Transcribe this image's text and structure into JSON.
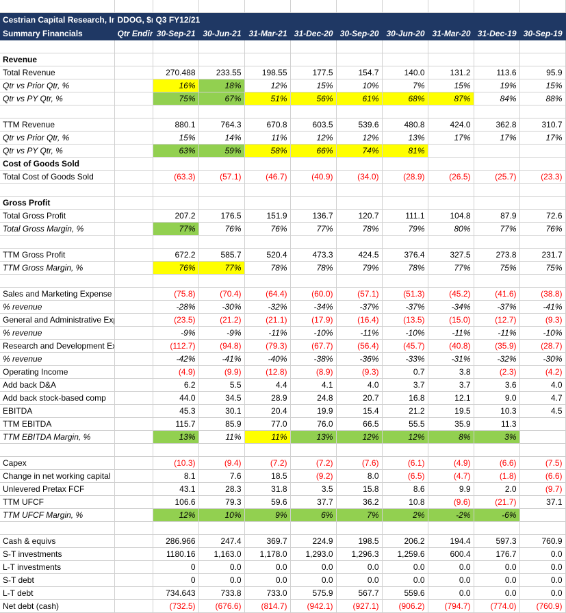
{
  "header": {
    "company_line1": "Cestrian Capital Research, Inc",
    "company_line2": "Summary Financials",
    "ticker": "DDOG, $m",
    "period": "Q3 FY12/21",
    "qtr_ending_label": "Qtr Ending",
    "columns": [
      "30-Sep-21",
      "30-Jun-21",
      "31-Mar-21",
      "31-Dec-20",
      "30-Sep-20",
      "30-Jun-20",
      "31-Mar-20",
      "31-Dec-19",
      "30-Sep-19"
    ]
  },
  "colors": {
    "header_navy": "#1F3864",
    "highlight_yellow": "#FFFF00",
    "highlight_green": "#92D050",
    "negative_red": "#FF0000"
  },
  "sections": [
    {
      "kind": "spacer"
    },
    {
      "kind": "title",
      "label": "Revenue"
    },
    {
      "kind": "row",
      "label": "Total Revenue",
      "style": "plain",
      "topRule": true,
      "values": [
        "270.488",
        "233.55",
        "198.55",
        "177.5",
        "154.7",
        "140.0",
        "131.2",
        "113.6",
        "95.9"
      ]
    },
    {
      "kind": "row",
      "label": "Qtr vs Prior Qtr, %",
      "style": "ital",
      "values": [
        "16%",
        "18%",
        "12%",
        "15%",
        "10%",
        "7%",
        "15%",
        "19%",
        "15%"
      ],
      "fills": [
        "y",
        "g",
        "",
        "",
        "",
        "",
        "",
        "",
        ""
      ]
    },
    {
      "kind": "row",
      "label": "Qtr vs PY Qtr, %",
      "style": "ital",
      "values": [
        "75%",
        "67%",
        "51%",
        "56%",
        "61%",
        "68%",
        "87%",
        "84%",
        "88%"
      ],
      "fills": [
        "g",
        "g",
        "y",
        "y",
        "y",
        "y",
        "y",
        "",
        ""
      ]
    },
    {
      "kind": "spacer"
    },
    {
      "kind": "row",
      "label": "TTM Revenue",
      "style": "plain",
      "values": [
        "880.1",
        "764.3",
        "670.8",
        "603.5",
        "539.6",
        "480.8",
        "424.0",
        "362.8",
        "310.7"
      ]
    },
    {
      "kind": "row",
      "label": "Qtr vs Prior Qtr, %",
      "style": "ital",
      "values": [
        "15%",
        "14%",
        "11%",
        "12%",
        "12%",
        "13%",
        "17%",
        "17%",
        "17%"
      ]
    },
    {
      "kind": "row",
      "label": "Qtr vs PY Qtr, %",
      "style": "ital",
      "values": [
        "63%",
        "59%",
        "58%",
        "66%",
        "74%",
        "81%",
        "",
        "",
        ""
      ],
      "fills": [
        "g",
        "g",
        "y",
        "y",
        "y",
        "y",
        "",
        "",
        ""
      ]
    },
    {
      "kind": "title",
      "label": "Cost of Goods Sold"
    },
    {
      "kind": "row",
      "label": "Total Cost of Goods Sold",
      "style": "neg",
      "values": [
        "(63.3)",
        "(57.1)",
        "(46.7)",
        "(40.9)",
        "(34.0)",
        "(28.9)",
        "(26.5)",
        "(25.7)",
        "(23.3)"
      ]
    },
    {
      "kind": "spacer"
    },
    {
      "kind": "title",
      "label": "Gross Profit"
    },
    {
      "kind": "row",
      "label": "Total Gross Profit",
      "style": "plain",
      "values": [
        "207.2",
        "176.5",
        "151.9",
        "136.7",
        "120.7",
        "111.1",
        "104.8",
        "87.9",
        "72.6"
      ]
    },
    {
      "kind": "row",
      "label": "Total Gross Margin, %",
      "style": "ital",
      "values": [
        "77%",
        "76%",
        "76%",
        "77%",
        "78%",
        "79%",
        "80%",
        "77%",
        "76%"
      ],
      "fills": [
        "g",
        "",
        "",
        "",
        "",
        "",
        "",
        "",
        ""
      ]
    },
    {
      "kind": "spacer"
    },
    {
      "kind": "row",
      "label": "TTM Gross Profit",
      "style": "plain",
      "values": [
        "672.2",
        "585.7",
        "520.4",
        "473.3",
        "424.5",
        "376.4",
        "327.5",
        "273.8",
        "231.7"
      ]
    },
    {
      "kind": "row",
      "label": "TTM Gross Margin, %",
      "style": "ital",
      "values": [
        "76%",
        "77%",
        "78%",
        "78%",
        "79%",
        "78%",
        "77%",
        "75%",
        "75%"
      ],
      "fills": [
        "y",
        "y",
        "",
        "",
        "",
        "",
        "",
        "",
        ""
      ]
    },
    {
      "kind": "spacer"
    },
    {
      "kind": "row",
      "label": "Sales and Marketing Expense",
      "style": "neg",
      "values": [
        "(75.8)",
        "(70.4)",
        "(64.4)",
        "(60.0)",
        "(57.1)",
        "(51.3)",
        "(45.2)",
        "(41.6)",
        "(38.8)"
      ]
    },
    {
      "kind": "row",
      "label": "% revenue",
      "style": "ital",
      "values": [
        "-28%",
        "-30%",
        "-32%",
        "-34%",
        "-37%",
        "-37%",
        "-34%",
        "-37%",
        "-41%"
      ]
    },
    {
      "kind": "row",
      "label": "General and Administrative Expense",
      "style": "neg",
      "values": [
        "(23.5)",
        "(21.2)",
        "(21.1)",
        "(17.9)",
        "(16.4)",
        "(13.5)",
        "(15.0)",
        "(12.7)",
        "(9.3)"
      ]
    },
    {
      "kind": "row",
      "label": "% revenue",
      "style": "ital",
      "values": [
        "-9%",
        "-9%",
        "-11%",
        "-10%",
        "-11%",
        "-10%",
        "-11%",
        "-11%",
        "-10%"
      ]
    },
    {
      "kind": "row",
      "label": "Research and Development Expense",
      "style": "neg",
      "values": [
        "(112.7)",
        "(94.8)",
        "(79.3)",
        "(67.7)",
        "(56.4)",
        "(45.7)",
        "(40.8)",
        "(35.9)",
        "(28.7)"
      ]
    },
    {
      "kind": "row",
      "label": "% revenue",
      "style": "ital",
      "values": [
        "-42%",
        "-41%",
        "-40%",
        "-38%",
        "-36%",
        "-33%",
        "-31%",
        "-32%",
        "-30%"
      ]
    },
    {
      "kind": "row",
      "label": "Operating Income",
      "style": "mixed",
      "values": [
        "(4.9)",
        "(9.9)",
        "(12.8)",
        "(8.9)",
        "(9.3)",
        "0.7",
        "3.8",
        "(2.3)",
        "(4.2)"
      ],
      "negflags": [
        true,
        true,
        true,
        true,
        true,
        false,
        false,
        true,
        true
      ]
    },
    {
      "kind": "row",
      "label": "Add back D&A",
      "style": "plain",
      "values": [
        "6.2",
        "5.5",
        "4.4",
        "4.1",
        "4.0",
        "3.7",
        "3.7",
        "3.6",
        "4.0"
      ]
    },
    {
      "kind": "row",
      "label": "Add back stock-based comp",
      "style": "plain",
      "values": [
        "44.0",
        "34.5",
        "28.9",
        "24.8",
        "20.7",
        "16.8",
        "12.1",
        "9.0",
        "4.7"
      ]
    },
    {
      "kind": "row",
      "label": "EBITDA",
      "style": "plain",
      "topRule": true,
      "values": [
        "45.3",
        "30.1",
        "20.4",
        "19.9",
        "15.4",
        "21.2",
        "19.5",
        "10.3",
        "4.5"
      ]
    },
    {
      "kind": "row",
      "label": "TTM EBITDA",
      "style": "plain",
      "values": [
        "115.7",
        "85.9",
        "77.0",
        "76.0",
        "66.5",
        "55.5",
        "35.9",
        "11.3",
        ""
      ]
    },
    {
      "kind": "row",
      "label": "TTM EBITDA Margin, %",
      "style": "ital",
      "values": [
        "13%",
        "11%",
        "11%",
        "13%",
        "12%",
        "12%",
        "8%",
        "3%",
        ""
      ],
      "fills": [
        "g",
        "",
        "y",
        "g",
        "g",
        "g",
        "g",
        "g",
        ""
      ]
    },
    {
      "kind": "spacer"
    },
    {
      "kind": "row",
      "label": "Capex",
      "style": "neg",
      "values": [
        "(10.3)",
        "(9.4)",
        "(7.2)",
        "(7.2)",
        "(7.6)",
        "(6.1)",
        "(4.9)",
        "(6.6)",
        "(7.5)"
      ]
    },
    {
      "kind": "row",
      "label": "Change in net working capital",
      "style": "mixed",
      "values": [
        "8.1",
        "7.6",
        "18.5",
        "(9.2)",
        "8.0",
        "(6.5)",
        "(4.7)",
        "(1.8)",
        "(6.6)"
      ],
      "negflags": [
        false,
        false,
        false,
        true,
        false,
        true,
        true,
        true,
        true
      ]
    },
    {
      "kind": "row",
      "label": "Unlevered Pretax FCF",
      "style": "mixed",
      "topRule": true,
      "values": [
        "43.1",
        "28.3",
        "31.8",
        "3.5",
        "15.8",
        "8.6",
        "9.9",
        "2.0",
        "(9.7)"
      ],
      "negflags": [
        false,
        false,
        false,
        false,
        false,
        false,
        false,
        false,
        true
      ]
    },
    {
      "kind": "row",
      "label": "TTM UFCF",
      "style": "mixed",
      "values": [
        "106.6",
        "79.3",
        "59.6",
        "37.7",
        "36.2",
        "10.8",
        "(9.6)",
        "(21.7)",
        "37.1"
      ],
      "negflags": [
        false,
        false,
        false,
        false,
        false,
        false,
        true,
        true,
        false
      ]
    },
    {
      "kind": "row",
      "label": "TTM UFCF Margin, %",
      "style": "ital",
      "values": [
        "12%",
        "10%",
        "9%",
        "6%",
        "7%",
        "2%",
        "-2%",
        "-6%",
        ""
      ],
      "fills": [
        "g",
        "g",
        "g",
        "g",
        "g",
        "g",
        "g",
        "g",
        ""
      ]
    },
    {
      "kind": "spacer"
    },
    {
      "kind": "row",
      "label": "Cash & equivs",
      "style": "plain",
      "values": [
        "286.966",
        "247.4",
        "369.7",
        "224.9",
        "198.5",
        "206.2",
        "194.4",
        "597.3",
        "760.9"
      ]
    },
    {
      "kind": "row",
      "label": "S-T investments",
      "style": "plain",
      "values": [
        "1180.16",
        "1,163.0",
        "1,178.0",
        "1,293.0",
        "1,296.3",
        "1,259.6",
        "600.4",
        "176.7",
        "0.0"
      ]
    },
    {
      "kind": "row",
      "label": "L-T investments",
      "style": "plain",
      "values": [
        "0",
        "0.0",
        "0.0",
        "0.0",
        "0.0",
        "0.0",
        "0.0",
        "0.0",
        "0.0"
      ]
    },
    {
      "kind": "row",
      "label": "S-T debt",
      "style": "plain",
      "values": [
        "0",
        "0.0",
        "0.0",
        "0.0",
        "0.0",
        "0.0",
        "0.0",
        "0.0",
        "0.0"
      ]
    },
    {
      "kind": "row",
      "label": "L-T debt",
      "style": "plain",
      "values": [
        "734.643",
        "733.8",
        "733.0",
        "575.9",
        "567.7",
        "559.6",
        "0.0",
        "0.0",
        "0.0"
      ]
    },
    {
      "kind": "row",
      "label": "Net debt (cash)",
      "style": "neg",
      "topRule": true,
      "values": [
        "(732.5)",
        "(676.6)",
        "(814.7)",
        "(942.1)",
        "(927.1)",
        "(906.2)",
        "(794.7)",
        "(774.0)",
        "(760.9)"
      ]
    }
  ]
}
